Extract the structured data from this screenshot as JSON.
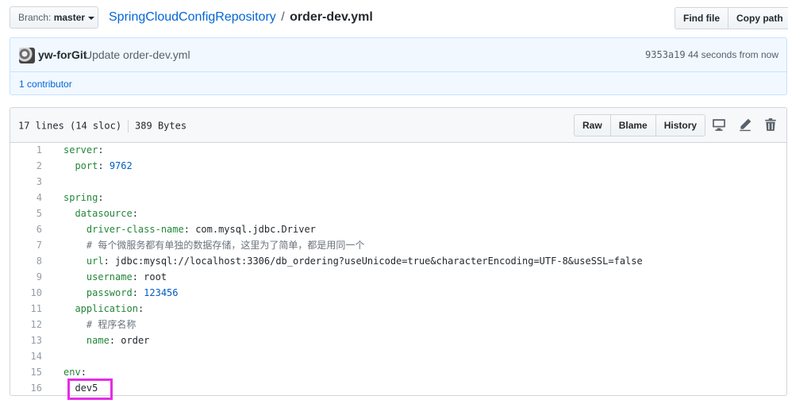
{
  "branch": {
    "label": "Branch:",
    "name": "master"
  },
  "breadcrumb": {
    "repo": "SpringCloudConfigRepository",
    "separator": "/",
    "file": "order-dev.yml"
  },
  "actions": {
    "find_file": "Find file",
    "copy_path": "Copy path"
  },
  "commit": {
    "author": "yw-forGit",
    "message": "Update order-dev.yml",
    "sha": "9353a19",
    "time": "44 seconds from now",
    "contributors_count": "1",
    "contributors_label": "contributor"
  },
  "file": {
    "lines_info": "17 lines (14 sloc)",
    "size": "389 Bytes",
    "raw": "Raw",
    "blame": "Blame",
    "history": "History"
  },
  "icons": [
    "desktop-icon",
    "pencil-icon",
    "trash-icon"
  ],
  "colors": {
    "link": "#0366d6",
    "key": "#22863a",
    "value": "#005cc5",
    "comment": "#6a737d",
    "highlight": "#e52de6"
  },
  "code_lines": [
    {
      "n": "1",
      "indent": "",
      "key": "server",
      "sep": ":",
      "val": "",
      "vtype": ""
    },
    {
      "n": "2",
      "indent": "  ",
      "key": "port",
      "sep": ": ",
      "val": "9762",
      "vtype": "v"
    },
    {
      "n": "3",
      "indent": "",
      "key": "",
      "sep": "",
      "val": "",
      "vtype": ""
    },
    {
      "n": "4",
      "indent": "",
      "key": "spring",
      "sep": ":",
      "val": "",
      "vtype": ""
    },
    {
      "n": "5",
      "indent": "  ",
      "key": "datasource",
      "sep": ":",
      "val": "",
      "vtype": ""
    },
    {
      "n": "6",
      "indent": "    ",
      "key": "driver-class-name",
      "sep": ": ",
      "val": "com.mysql.jdbc.Driver",
      "vtype": "p"
    },
    {
      "n": "7",
      "indent": "    ",
      "key": "",
      "sep": "",
      "val": "# 每个微服务都有单独的数据存储，这里为了简单，都是用同一个",
      "vtype": "c"
    },
    {
      "n": "8",
      "indent": "    ",
      "key": "url",
      "sep": ": ",
      "val": "jdbc:mysql://localhost:3306/db_ordering?useUnicode=true&characterEncoding=UTF-8&useSSL=false",
      "vtype": "p"
    },
    {
      "n": "9",
      "indent": "    ",
      "key": "username",
      "sep": ": ",
      "val": "root",
      "vtype": "p"
    },
    {
      "n": "10",
      "indent": "    ",
      "key": "password",
      "sep": ": ",
      "val": "123456",
      "vtype": "v"
    },
    {
      "n": "11",
      "indent": "  ",
      "key": "application",
      "sep": ":",
      "val": "",
      "vtype": ""
    },
    {
      "n": "12",
      "indent": "    ",
      "key": "",
      "sep": "",
      "val": "# 程序名称",
      "vtype": "c"
    },
    {
      "n": "13",
      "indent": "    ",
      "key": "name",
      "sep": ": ",
      "val": "order",
      "vtype": "p"
    },
    {
      "n": "14",
      "indent": "",
      "key": "",
      "sep": "",
      "val": "",
      "vtype": ""
    },
    {
      "n": "15",
      "indent": "",
      "key": "env",
      "sep": ":",
      "val": "",
      "vtype": ""
    },
    {
      "n": "16",
      "indent": "  ",
      "key": "",
      "sep": "",
      "val": "dev5",
      "vtype": "p"
    }
  ]
}
